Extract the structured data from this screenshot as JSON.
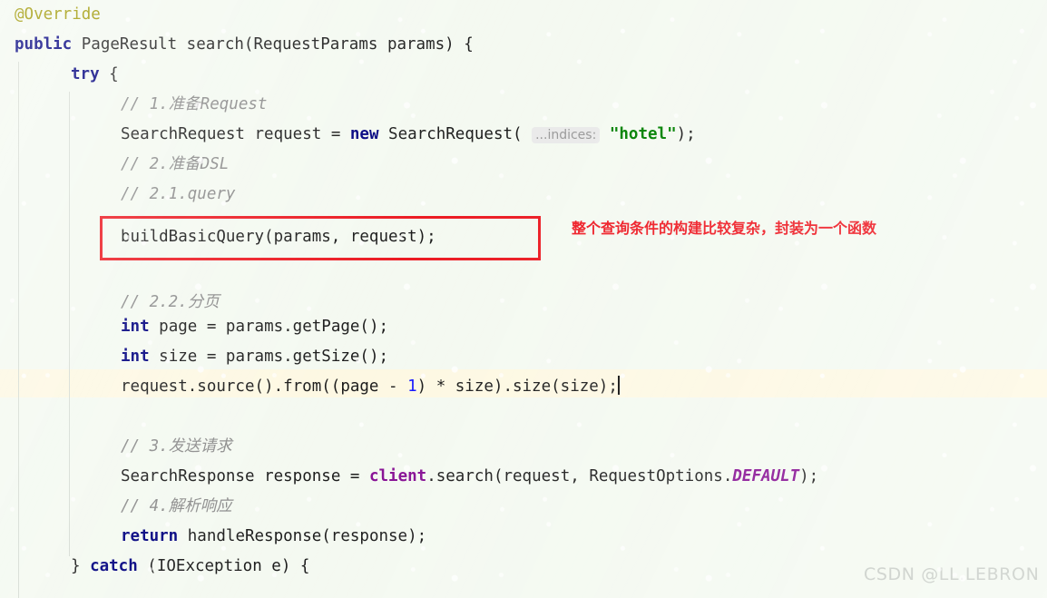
{
  "editor": {
    "language": "Java",
    "background_color": "#f4f9f1",
    "caret_line_color": "#fdf8e3",
    "indent_guide_color": "#d6dcd4",
    "lines": [
      {
        "n": 1,
        "indent": 16,
        "text": "@Override"
      },
      {
        "n": 2,
        "indent": 16,
        "text": "public PageResult search(RequestParams params) {"
      },
      {
        "n": 3,
        "indent": 78,
        "text": "try {"
      },
      {
        "n": 4,
        "indent": 133,
        "text": "// 1.准备Request"
      },
      {
        "n": 5,
        "indent": 133,
        "text": "SearchRequest request = new SearchRequest( ...indices: \"hotel\");"
      },
      {
        "n": 6,
        "indent": 133,
        "text": "// 2.准备DSL"
      },
      {
        "n": 7,
        "indent": 133,
        "text": "// 2.1.query"
      },
      {
        "n": 8,
        "indent": 133,
        "text": "buildBasicQuery(params, request);"
      },
      {
        "n": 9,
        "indent": 133,
        "text": ""
      },
      {
        "n": 10,
        "indent": 133,
        "text": "// 2.2.分页"
      },
      {
        "n": 11,
        "indent": 133,
        "text": "int page = params.getPage();"
      },
      {
        "n": 12,
        "indent": 133,
        "text": "int size = params.getSize();"
      },
      {
        "n": 13,
        "indent": 133,
        "text": "request.source().from((page - 1) * size).size(size);"
      },
      {
        "n": 14,
        "indent": 133,
        "text": ""
      },
      {
        "n": 15,
        "indent": 133,
        "text": "// 3.发送请求"
      },
      {
        "n": 16,
        "indent": 133,
        "text": "SearchResponse response = client.search(request, RequestOptions.DEFAULT);"
      },
      {
        "n": 17,
        "indent": 133,
        "text": "// 4.解析响应"
      },
      {
        "n": 18,
        "indent": 133,
        "text": "return handleResponse(response);"
      },
      {
        "n": 19,
        "indent": 78,
        "text": "} catch (IOException e) {"
      }
    ],
    "tokens": {
      "annotation_override": "@Override",
      "kw_public": "public",
      "kw_try": "try",
      "kw_new": "new",
      "kw_int": "int",
      "kw_return": "return",
      "kw_catch": "catch",
      "type_page_result": "PageResult",
      "method_search": "search",
      "type_request_params": "RequestParams",
      "param_params": "params",
      "type_search_request": "SearchRequest",
      "var_request": "request",
      "param_hint_indices": "...indices:",
      "string_hotel": "\"hotel\"",
      "call_build_basic_query": "buildBasicQuery(params, request);",
      "var_page": "page",
      "var_size": "size",
      "number_one": "1",
      "type_search_response": "SearchResponse",
      "var_response": "response",
      "field_client": "client",
      "type_request_options": "RequestOptions",
      "static_default": "DEFAULT",
      "call_handle_response": "handleResponse(response);",
      "type_io_exception": "IOException",
      "var_e": "e"
    },
    "comments": {
      "c1": "// 1.准备Request",
      "c2": "// 2.准备DSL",
      "c3": "// 2.1.query",
      "c4": "// 2.2.分页",
      "c5": "// 3.发送请求",
      "c6": "// 4.解析响应"
    },
    "caret_line_number": 13
  },
  "annotations": {
    "red_note_text": "整个查询条件的构建比较复杂，封装为一个函数",
    "red_note_color": "#ee1c25",
    "red_box_color": "#ec1c24",
    "red_box_target_line": 8
  },
  "watermark": {
    "text": "CSDN @LL.LEBRON",
    "color": "#c7ccc6"
  }
}
